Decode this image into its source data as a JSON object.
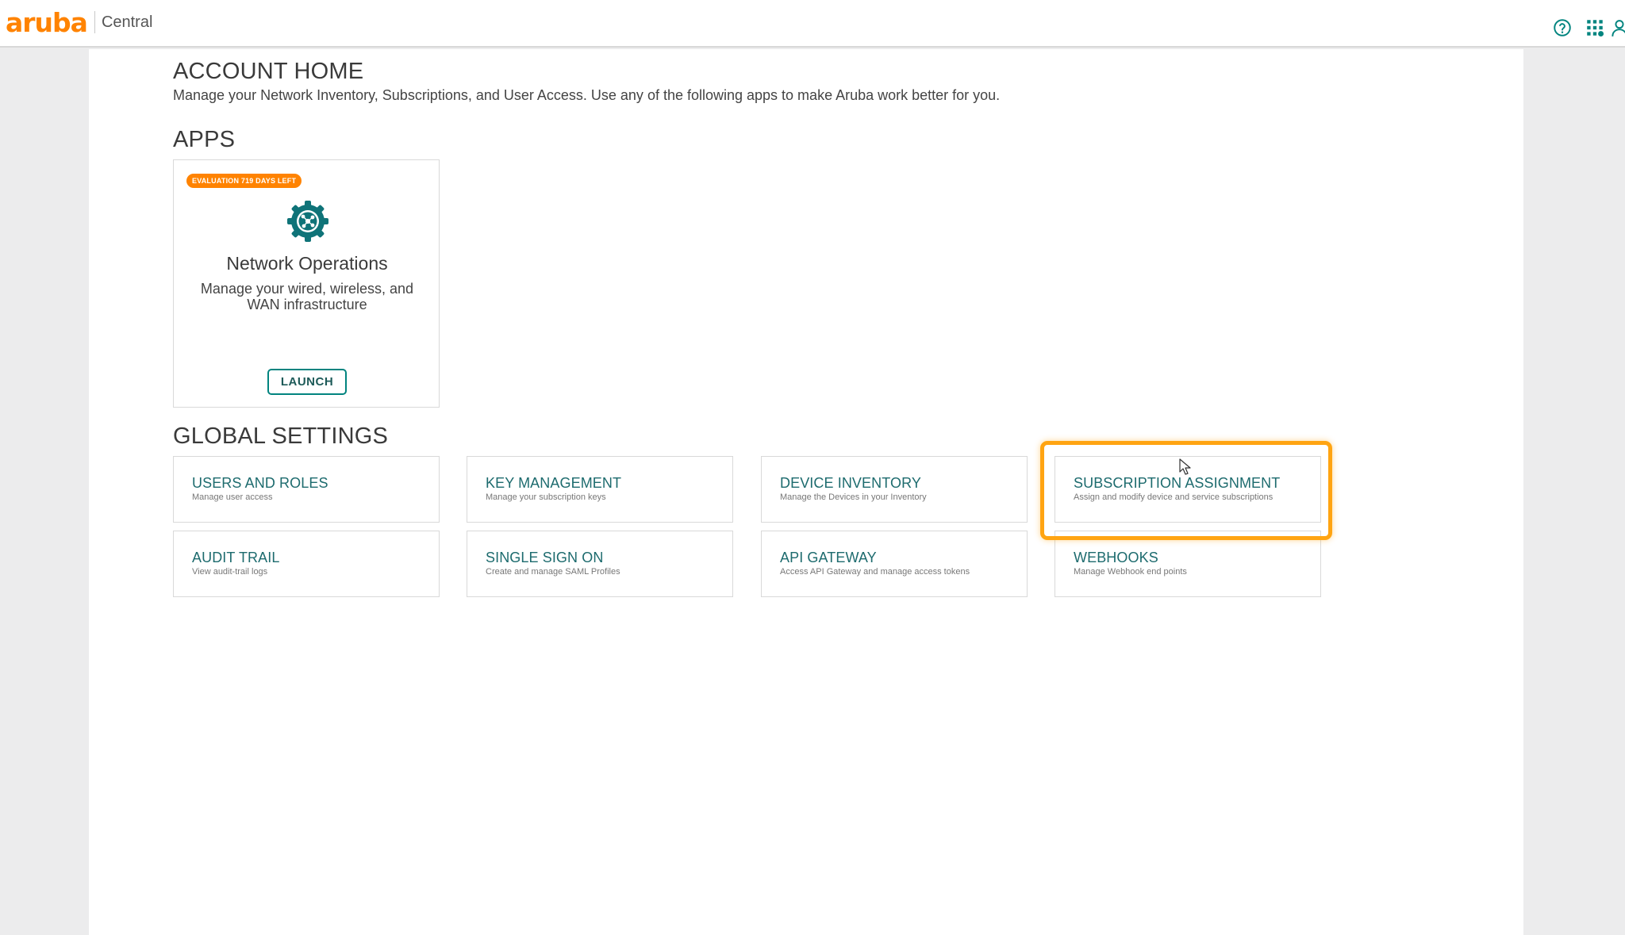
{
  "topbar": {
    "logo_text": "aruba",
    "product_name": "Central",
    "brand_color": "#ff8300",
    "icons": [
      "help-icon",
      "apps-grid-icon",
      "user-icon"
    ]
  },
  "page": {
    "title": "ACCOUNT HOME",
    "subtitle": "Manage your Network Inventory, Subscriptions, and User Access. Use any of the following apps to make Aruba work better for you."
  },
  "apps_section": {
    "title": "APPS",
    "cards": [
      {
        "badge": "EVALUATION 719 DAYS LEFT",
        "icon": "network-operations-gear-icon",
        "title": "Network Operations",
        "description": "Manage your wired, wireless, and WAN infrastructure",
        "button_label": "LAUNCH"
      }
    ]
  },
  "global_settings": {
    "title": "GLOBAL SETTINGS",
    "tiles": [
      {
        "title": "USERS AND ROLES",
        "description": "Manage user access"
      },
      {
        "title": "KEY MANAGEMENT",
        "description": "Manage your subscription keys"
      },
      {
        "title": "DEVICE INVENTORY",
        "description": "Manage the Devices in your Inventory"
      },
      {
        "title": "SUBSCRIPTION ASSIGNMENT",
        "description": "Assign and modify device and service subscriptions"
      },
      {
        "title": "AUDIT TRAIL",
        "description": "View audit-trail logs"
      },
      {
        "title": "SINGLE SIGN ON",
        "description": "Create and manage SAML Profiles"
      },
      {
        "title": "API GATEWAY",
        "description": "Access API Gateway and manage access tokens"
      },
      {
        "title": "WEBHOOKS",
        "description": "Manage Webhook end points"
      }
    ]
  },
  "colors": {
    "accent": "#01847f",
    "tile_title": "#1d6b6e",
    "highlight": "#ffa412",
    "badge": "#ff8300"
  }
}
